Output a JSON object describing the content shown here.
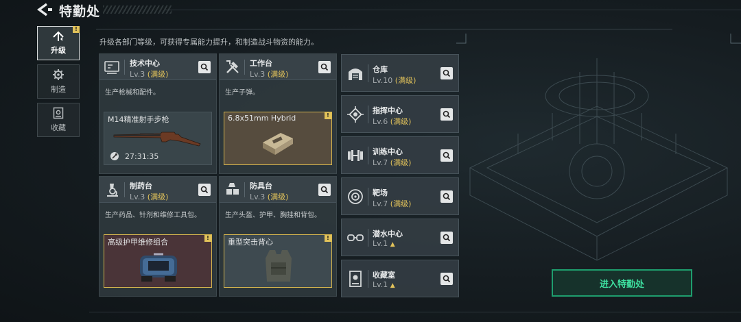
{
  "header": {
    "title": "特勤处"
  },
  "sidebar": {
    "tabs": [
      {
        "label": "升级",
        "icon": "upgrade-icon",
        "active": true,
        "badge": "!"
      },
      {
        "label": "制造",
        "icon": "manufacture-gear-icon",
        "active": false
      },
      {
        "label": "收藏",
        "icon": "collection-icon",
        "active": false
      }
    ]
  },
  "description": "升级各部门等级，可获得专属能力提升，和制造战斗物资的能力。",
  "cards": [
    {
      "name": "技术中心",
      "level": "Lv.3",
      "max": "(满级)",
      "desc": "生产枪械和配件。",
      "product": "M14精准射手步枪",
      "timer": "27:31:35",
      "icon": "tech-center-icon"
    },
    {
      "name": "工作台",
      "level": "Lv.3",
      "max": "(满级)",
      "desc": "生产子弹。",
      "product": "6.8x51mm Hybrid",
      "badge": "!",
      "icon": "workbench-tools-icon"
    },
    {
      "name": "制药台",
      "level": "Lv.3",
      "max": "(满级)",
      "desc": "生产药品、针剂和维修工具包。",
      "product": "高级护甲维修组合",
      "badge": "!",
      "icon": "pharmacy-microscope-icon"
    },
    {
      "name": "防具台",
      "level": "Lv.3",
      "max": "(满级)",
      "desc": "生产头盔、护甲、胸挂和背包。",
      "product": "重型突击背心",
      "badge": "!",
      "icon": "armor-bench-icon"
    }
  ],
  "facilities": [
    {
      "name": "仓库",
      "level": "Lv.10",
      "max": "(满级)",
      "icon": "warehouse-icon"
    },
    {
      "name": "指挥中心",
      "level": "Lv.6",
      "max": "(满级)",
      "icon": "command-chip-icon"
    },
    {
      "name": "训练中心",
      "level": "Lv.7",
      "max": "(满级)",
      "icon": "dumbbell-icon"
    },
    {
      "name": "靶场",
      "level": "Lv.7",
      "max": "(满级)",
      "icon": "target-icon"
    },
    {
      "name": "潜水中心",
      "level": "Lv.1",
      "max": "",
      "upgradable": true,
      "icon": "diving-goggles-icon"
    },
    {
      "name": "收藏室",
      "level": "Lv.1",
      "max": "",
      "upgradable": true,
      "icon": "collection-room-icon"
    }
  ],
  "enter_button": "进入特勤处",
  "colors": {
    "accent_max": "#e1c25a",
    "enter_green": "#3ee0a0",
    "highlight_border": "#d9b84e"
  }
}
